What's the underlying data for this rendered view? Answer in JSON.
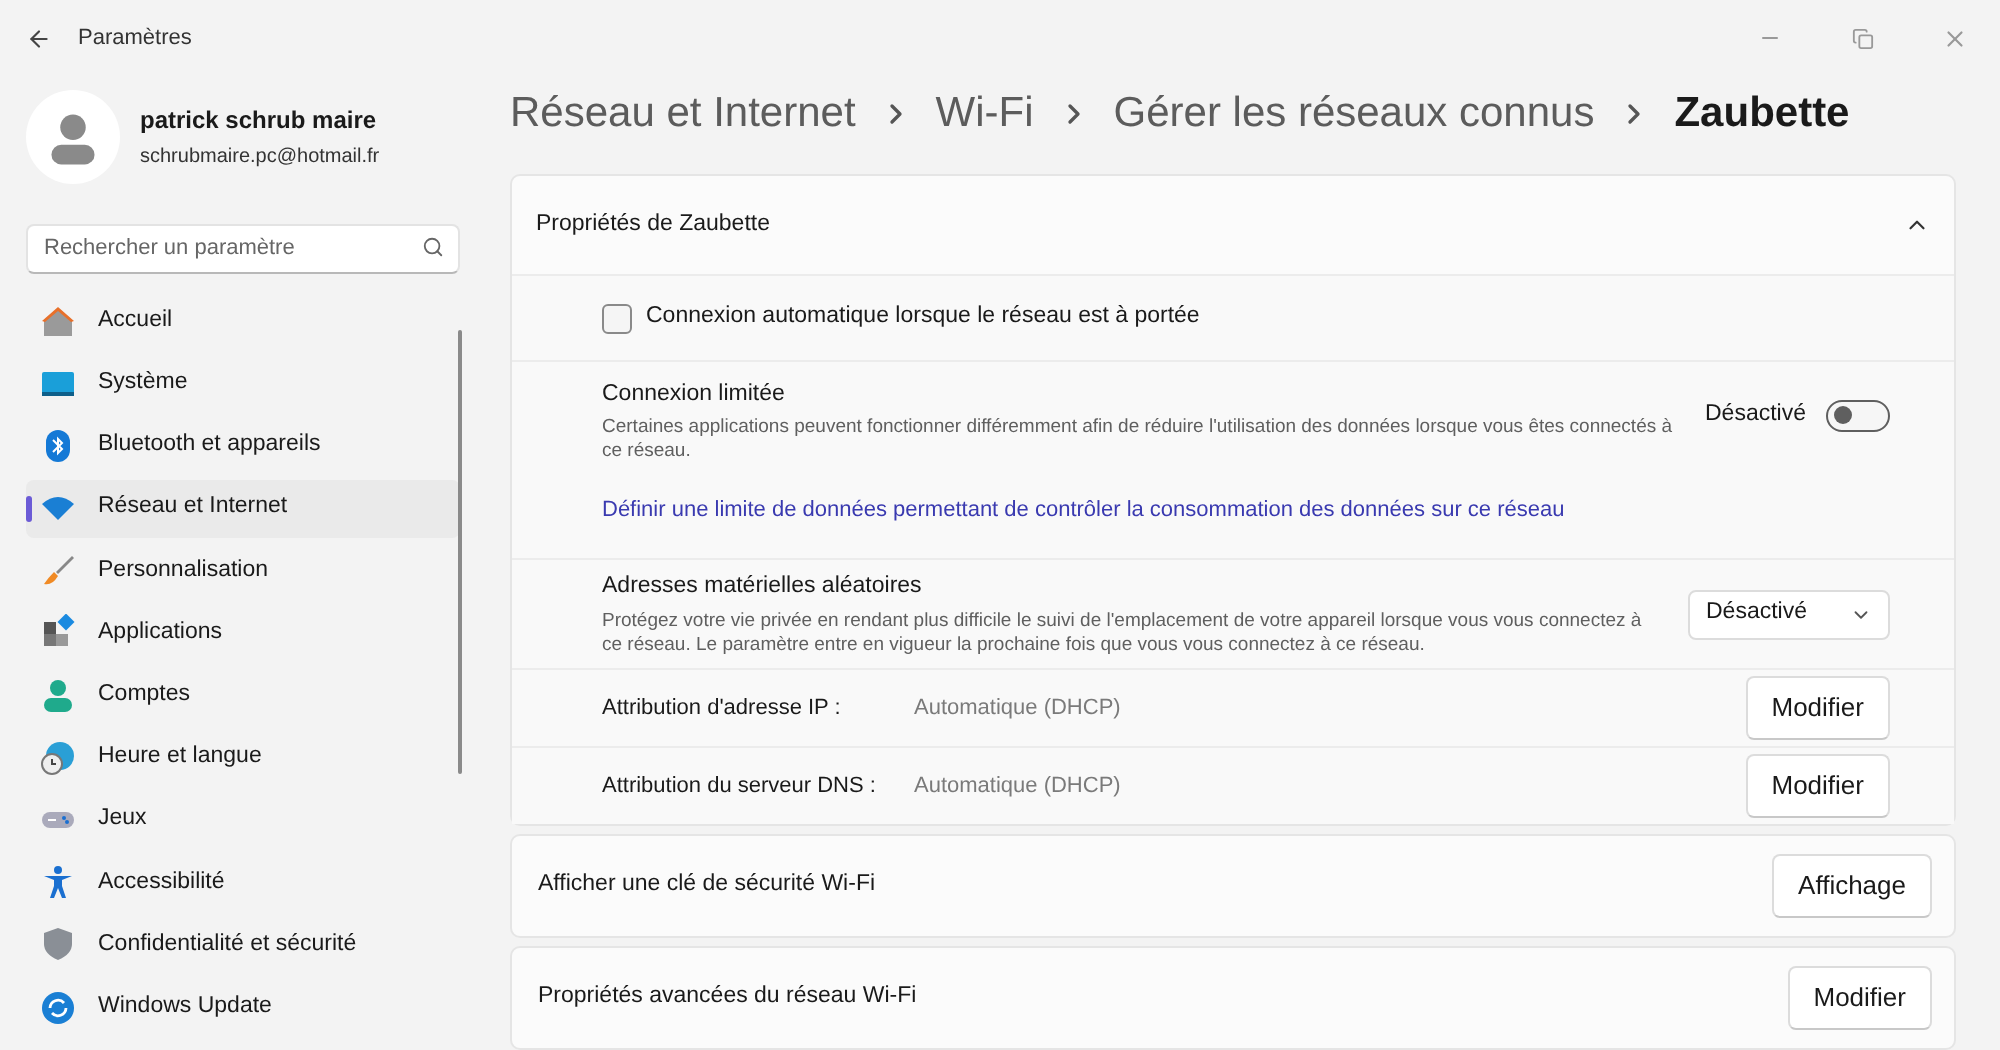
{
  "window": {
    "title": "Paramètres"
  },
  "account": {
    "name": "patrick schrub maire",
    "email": "schrubmaire.pc@hotmail.fr"
  },
  "search": {
    "placeholder": "Rechercher un paramètre"
  },
  "nav": [
    {
      "label": "Accueil",
      "selected": false
    },
    {
      "label": "Système",
      "selected": false
    },
    {
      "label": "Bluetooth et appareils",
      "selected": false
    },
    {
      "label": "Réseau et Internet",
      "selected": true
    },
    {
      "label": "Personnalisation",
      "selected": false
    },
    {
      "label": "Applications",
      "selected": false
    },
    {
      "label": "Comptes",
      "selected": false
    },
    {
      "label": "Heure et langue",
      "selected": false
    },
    {
      "label": "Jeux",
      "selected": false
    },
    {
      "label": "Accessibilité",
      "selected": false
    },
    {
      "label": "Confidentialité et sécurité",
      "selected": false
    },
    {
      "label": "Windows Update",
      "selected": false
    }
  ],
  "breadcrumb": [
    "Réseau et Internet",
    "Wi-Fi",
    "Gérer les réseaux connus",
    "Zaubette"
  ],
  "properties": {
    "title": "Propriétés de Zaubette",
    "expanded": true,
    "auto_connect": {
      "label": "Connexion automatique lorsque le réseau est à portée",
      "checked": false
    },
    "metered": {
      "title": "Connexion limitée",
      "description": "Certaines applications peuvent fonctionner différemment afin de réduire l'utilisation des données lorsque vous êtes connectés à ce réseau.",
      "state_label": "Désactivé",
      "on": false,
      "link": "Définir une limite de données permettant de contrôler la consommation des données sur ce réseau"
    },
    "random_hw": {
      "title": "Adresses matérielles aléatoires",
      "description": "Protégez votre vie privée en rendant plus difficile le suivi de l'emplacement de votre appareil lorsque vous vous connectez à ce réseau. Le paramètre entre en vigueur la prochaine fois que vous vous connectez à ce réseau.",
      "value": "Désactivé"
    },
    "ip": {
      "label": "Attribution d'adresse IP :",
      "value": "Automatique (DHCP)",
      "button": "Modifier"
    },
    "dns": {
      "label": "Attribution du serveur DNS :",
      "value": "Automatique (DHCP)",
      "button": "Modifier"
    }
  },
  "security_key": {
    "label": "Afficher une clé de sécurité Wi-Fi",
    "button": "Affichage"
  },
  "advanced": {
    "label": "Propriétés avancées du réseau Wi-Fi",
    "button": "Modifier"
  }
}
